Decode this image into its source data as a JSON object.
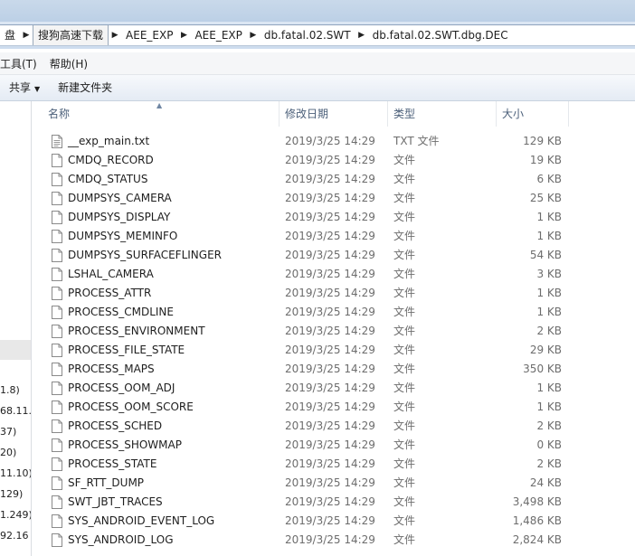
{
  "breadcrumb": {
    "items": [
      "盘",
      "搜狗高速下载",
      "AEE_EXP",
      "AEE_EXP",
      "db.fatal.02.SWT",
      "db.fatal.02.SWT.dbg.DEC"
    ]
  },
  "menu": {
    "items": [
      "工具(T)",
      "帮助(H)"
    ]
  },
  "toolbar": {
    "share_label": "共享",
    "new_folder_label": "新建文件夹"
  },
  "nav": {
    "items": [
      "1.8)",
      "68.11.",
      "37)",
      "20)",
      "11.10)",
      "129)",
      "1.249)",
      "92.16"
    ]
  },
  "columns": {
    "name": "名称",
    "date": "修改日期",
    "type": "类型",
    "size": "大小"
  },
  "files": [
    {
      "name": "__exp_main.txt",
      "date": "2019/3/25 14:29",
      "type": "TXT 文件",
      "size": "129 KB",
      "icon": "text-file-icon"
    },
    {
      "name": "CMDQ_RECORD",
      "date": "2019/3/25 14:29",
      "type": "文件",
      "size": "19 KB",
      "icon": "file-icon"
    },
    {
      "name": "CMDQ_STATUS",
      "date": "2019/3/25 14:29",
      "type": "文件",
      "size": "6 KB",
      "icon": "file-icon"
    },
    {
      "name": "DUMPSYS_CAMERA",
      "date": "2019/3/25 14:29",
      "type": "文件",
      "size": "25 KB",
      "icon": "file-icon"
    },
    {
      "name": "DUMPSYS_DISPLAY",
      "date": "2019/3/25 14:29",
      "type": "文件",
      "size": "1 KB",
      "icon": "file-icon"
    },
    {
      "name": "DUMPSYS_MEMINFO",
      "date": "2019/3/25 14:29",
      "type": "文件",
      "size": "1 KB",
      "icon": "file-icon"
    },
    {
      "name": "DUMPSYS_SURFACEFLINGER",
      "date": "2019/3/25 14:29",
      "type": "文件",
      "size": "54 KB",
      "icon": "file-icon"
    },
    {
      "name": "LSHAL_CAMERA",
      "date": "2019/3/25 14:29",
      "type": "文件",
      "size": "3 KB",
      "icon": "file-icon"
    },
    {
      "name": "PROCESS_ATTR",
      "date": "2019/3/25 14:29",
      "type": "文件",
      "size": "1 KB",
      "icon": "file-icon"
    },
    {
      "name": "PROCESS_CMDLINE",
      "date": "2019/3/25 14:29",
      "type": "文件",
      "size": "1 KB",
      "icon": "file-icon"
    },
    {
      "name": "PROCESS_ENVIRONMENT",
      "date": "2019/3/25 14:29",
      "type": "文件",
      "size": "2 KB",
      "icon": "file-icon"
    },
    {
      "name": "PROCESS_FILE_STATE",
      "date": "2019/3/25 14:29",
      "type": "文件",
      "size": "29 KB",
      "icon": "file-icon"
    },
    {
      "name": "PROCESS_MAPS",
      "date": "2019/3/25 14:29",
      "type": "文件",
      "size": "350 KB",
      "icon": "file-icon"
    },
    {
      "name": "PROCESS_OOM_ADJ",
      "date": "2019/3/25 14:29",
      "type": "文件",
      "size": "1 KB",
      "icon": "file-icon"
    },
    {
      "name": "PROCESS_OOM_SCORE",
      "date": "2019/3/25 14:29",
      "type": "文件",
      "size": "1 KB",
      "icon": "file-icon"
    },
    {
      "name": "PROCESS_SCHED",
      "date": "2019/3/25 14:29",
      "type": "文件",
      "size": "2 KB",
      "icon": "file-icon"
    },
    {
      "name": "PROCESS_SHOWMAP",
      "date": "2019/3/25 14:29",
      "type": "文件",
      "size": "0 KB",
      "icon": "file-icon"
    },
    {
      "name": "PROCESS_STATE",
      "date": "2019/3/25 14:29",
      "type": "文件",
      "size": "2 KB",
      "icon": "file-icon"
    },
    {
      "name": "SF_RTT_DUMP",
      "date": "2019/3/25 14:29",
      "type": "文件",
      "size": "24 KB",
      "icon": "file-icon"
    },
    {
      "name": "SWT_JBT_TRACES",
      "date": "2019/3/25 14:29",
      "type": "文件",
      "size": "3,498 KB",
      "icon": "file-icon"
    },
    {
      "name": "SYS_ANDROID_EVENT_LOG",
      "date": "2019/3/25 14:29",
      "type": "文件",
      "size": "1,486 KB",
      "icon": "file-icon"
    },
    {
      "name": "SYS_ANDROID_LOG",
      "date": "2019/3/25 14:29",
      "type": "文件",
      "size": "2,824 KB",
      "icon": "file-icon"
    }
  ]
}
